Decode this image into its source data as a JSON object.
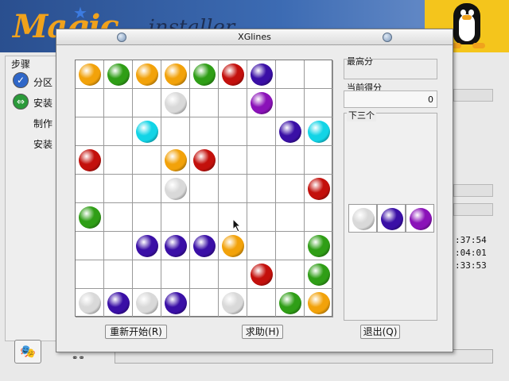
{
  "background": {
    "logo_text": "Magic",
    "logo_tail": "..installer",
    "steps_title": "步骤",
    "steps": [
      {
        "label": "分区",
        "icon": "check-icon"
      },
      {
        "label": "安装",
        "icon": "swap-icon"
      },
      {
        "label": "制作",
        "icon": null
      },
      {
        "label": "安装",
        "icon": null
      }
    ],
    "times": [
      ":37:54",
      ":04:01",
      ":33:53"
    ]
  },
  "window": {
    "title": "XGlines"
  },
  "colors": {
    "yellow": "#f2a20a",
    "green": "#2f9e16",
    "red": "#c3100c",
    "purple": "#3a0fa6",
    "violet": "#8a12b8",
    "cyan": "#12d4e6",
    "white": "#d9d9d9"
  },
  "board": {
    "rows": [
      [
        "yellow",
        "green",
        "yellow",
        "yellow",
        "green",
        "red",
        "purple",
        null,
        null
      ],
      [
        null,
        null,
        null,
        "white",
        null,
        null,
        "violet",
        null,
        null
      ],
      [
        null,
        null,
        "cyan",
        null,
        null,
        null,
        null,
        "purple",
        "cyan"
      ],
      [
        "red",
        null,
        null,
        "yellow",
        "red",
        null,
        null,
        null,
        null
      ],
      [
        null,
        null,
        null,
        "white",
        null,
        null,
        null,
        null,
        "red"
      ],
      [
        "green",
        null,
        null,
        null,
        null,
        null,
        null,
        null,
        null
      ],
      [
        null,
        null,
        "purple",
        "purple",
        "purple",
        "yellow",
        null,
        null,
        "green"
      ],
      [
        null,
        null,
        null,
        null,
        null,
        null,
        "red",
        null,
        "green"
      ],
      [
        "white",
        "purple",
        "white",
        "purple",
        null,
        "white",
        null,
        "green",
        "yellow"
      ]
    ]
  },
  "scores": {
    "high_label": "最高分",
    "high_value": "",
    "current_label": "当前得分",
    "current_value": "0"
  },
  "next": {
    "label": "下三个",
    "balls": [
      "white",
      "purple",
      "violet"
    ]
  },
  "buttons": {
    "restart": "重新开始(R)",
    "help": "求助(H)",
    "quit": "退出(Q)"
  }
}
